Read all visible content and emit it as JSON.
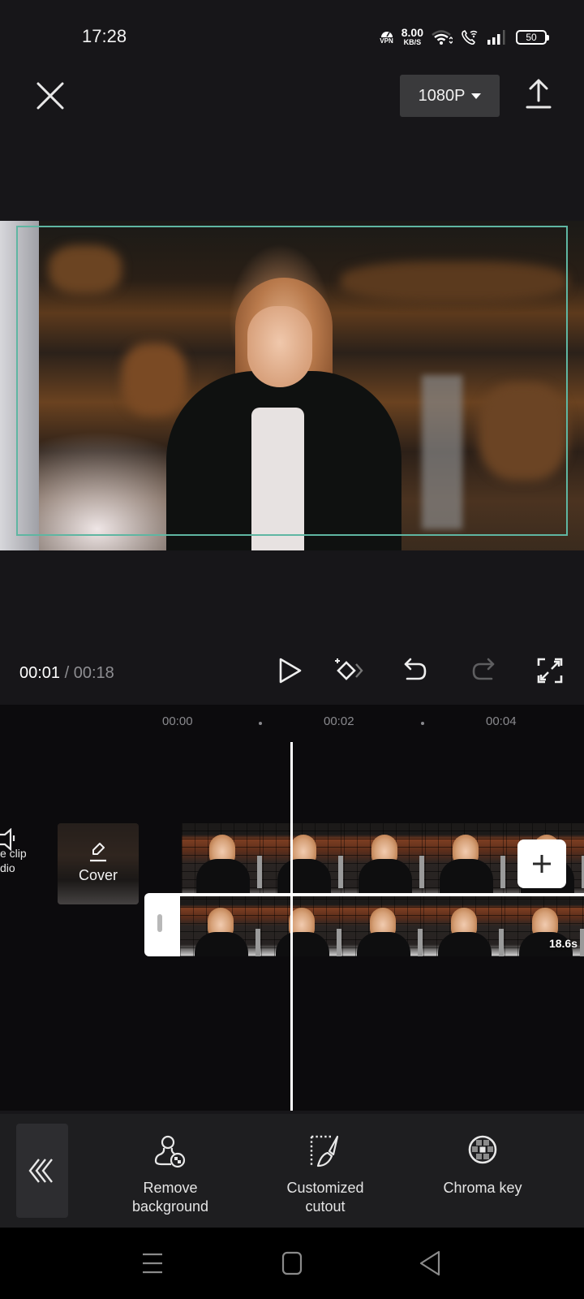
{
  "status_bar": {
    "time": "17:28",
    "vpn_label": "VPN",
    "net_speed_value": "8.00",
    "net_speed_unit": "KB/S",
    "battery_level": "50",
    "icons": [
      "vpn-icon",
      "wifi-icon",
      "wifi-calling-icon",
      "signal-icon",
      "battery-icon"
    ]
  },
  "top_bar": {
    "close_icon": "close-icon",
    "resolution": "1080P",
    "export_icon": "export-icon"
  },
  "preview": {
    "frame_color": "#5fb6a2"
  },
  "playback": {
    "current_time": "00:01",
    "separator": " / ",
    "total_time": "00:18",
    "controls": [
      {
        "name": "play",
        "icon": "play-icon"
      },
      {
        "name": "keyframe",
        "icon": "add-keyframe-icon"
      },
      {
        "name": "undo",
        "icon": "undo-icon"
      },
      {
        "name": "redo",
        "icon": "redo-icon",
        "disabled": true
      },
      {
        "name": "fullscreen",
        "icon": "fullscreen-icon"
      }
    ]
  },
  "timeline": {
    "ruler": [
      "00:00",
      "00:02",
      "00:04"
    ],
    "mute_clip_label_line1": "e clip",
    "mute_clip_label_line2": "dio",
    "cover_label": "Cover",
    "main_track_duration": "18.6s",
    "add_clip_icon": "plus-icon"
  },
  "toolbar": {
    "back_icon": "triple-chevron-left-icon",
    "tools": [
      {
        "label_line1": "Remove",
        "label_line2": "background",
        "icon": "remove-background-icon"
      },
      {
        "label_line1": "Customized",
        "label_line2": "cutout",
        "icon": "cutout-brush-icon"
      },
      {
        "label_line1": "Chroma key",
        "label_line2": "",
        "icon": "chroma-key-icon"
      }
    ]
  },
  "navbar": {
    "buttons": [
      "menu-icon",
      "home-icon",
      "back-icon"
    ]
  }
}
